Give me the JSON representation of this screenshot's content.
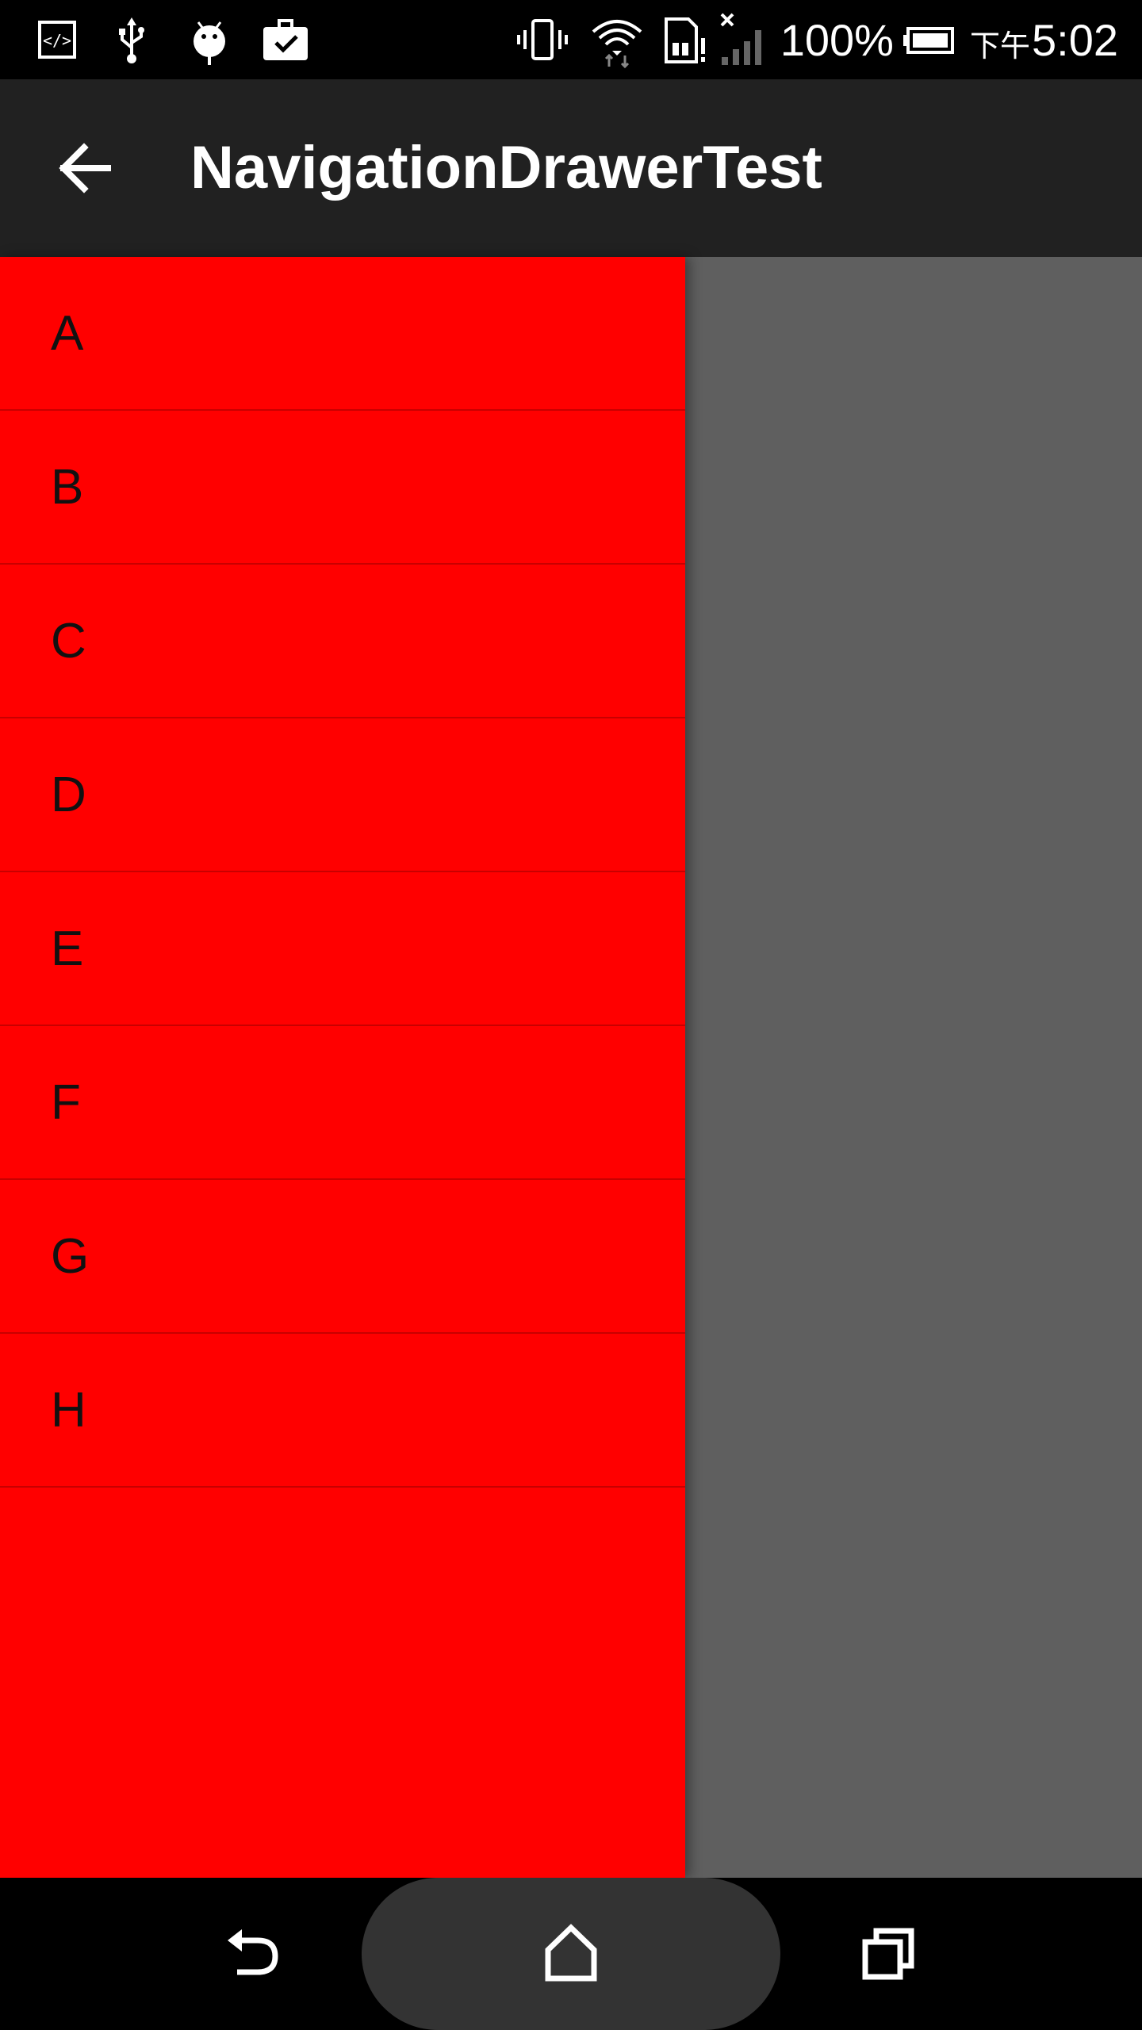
{
  "status_bar": {
    "battery": "100%",
    "time": "5:02",
    "ampm": "下午",
    "icons": [
      "code-icon",
      "usb-icon",
      "android-debug-icon",
      "briefcase-check-icon",
      "vibrate-icon",
      "wifi-icon",
      "sim-alert-icon",
      "signal-icon",
      "battery-icon"
    ]
  },
  "app_bar": {
    "title": "NavigationDrawerTest",
    "back_icon": "arrow-back-icon"
  },
  "drawer": {
    "items": [
      {
        "label": "A"
      },
      {
        "label": "B"
      },
      {
        "label": "C"
      },
      {
        "label": "D"
      },
      {
        "label": "E"
      },
      {
        "label": "F"
      },
      {
        "label": "G"
      },
      {
        "label": "H"
      }
    ],
    "color": "#ff0000"
  },
  "nav_bar": {
    "icons": [
      "back-icon",
      "home-icon",
      "recents-icon"
    ]
  },
  "colors": {
    "app_bar": "#212121",
    "drawer": "#ff0000",
    "scrim": "#5f5f5f",
    "status_bar": "#000000"
  }
}
